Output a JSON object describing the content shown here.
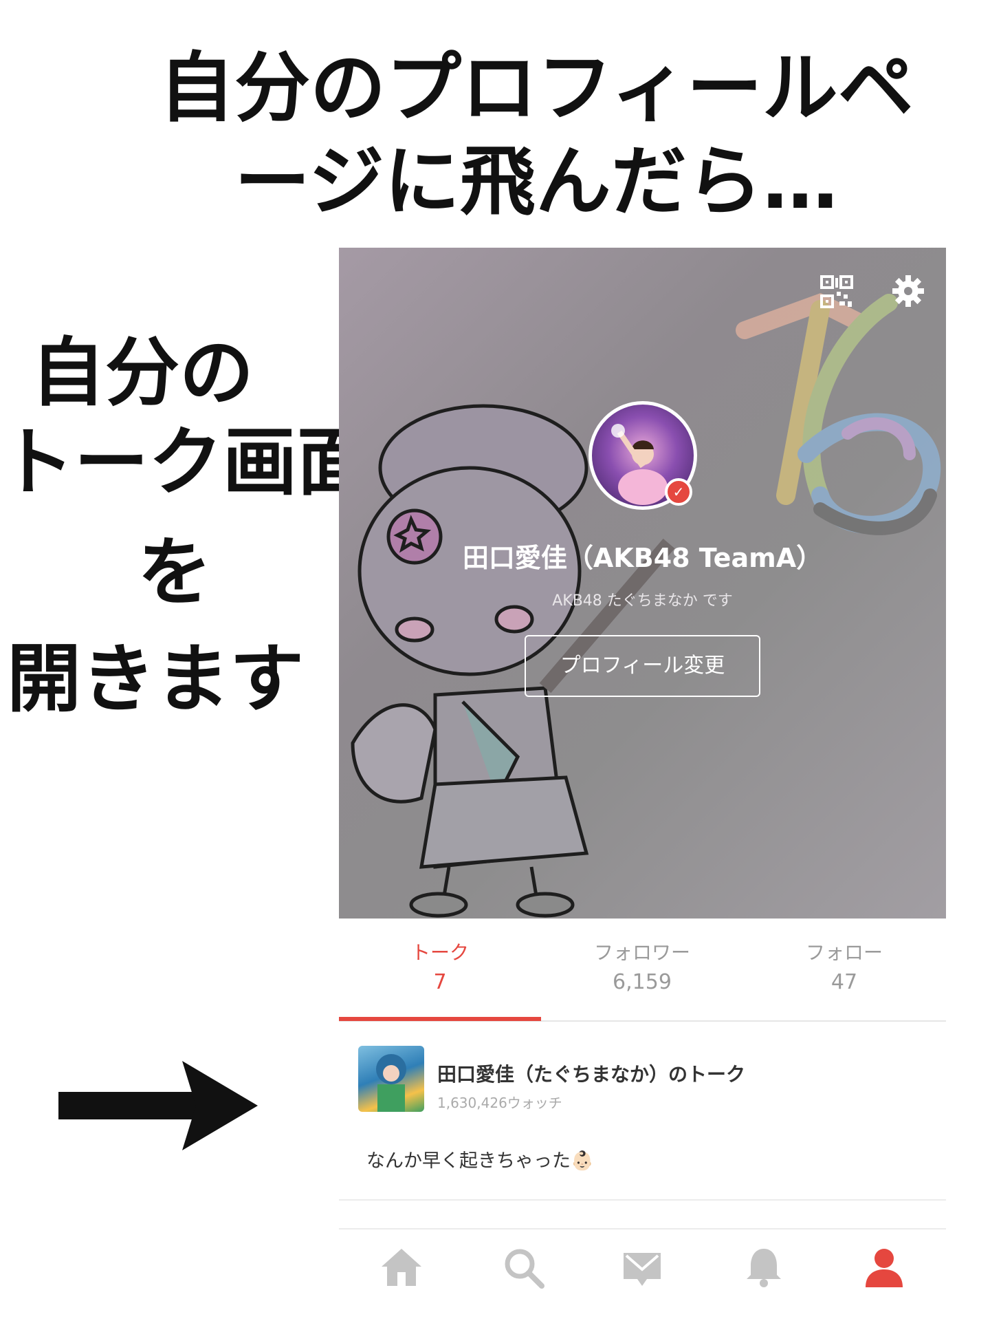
{
  "caption": {
    "title_line1": "自分のプロフィールペ",
    "title_line2": "ージに飛んだら…",
    "side_line1": "自分の",
    "side_line2": "トーク画面",
    "side_line3": "を",
    "side_line4": "開きます"
  },
  "profile": {
    "name": "田口愛佳（AKB48 TeamA）",
    "bio": "AKB48 たぐちまなか です",
    "edit_button": "プロフィール変更",
    "icons": [
      "qr-code-icon",
      "gear-icon",
      "verified-badge"
    ]
  },
  "stats": [
    {
      "label": "トーク",
      "count": "7",
      "active": true
    },
    {
      "label": "フォロワー",
      "count": "6,159",
      "active": false
    },
    {
      "label": "フォロー",
      "count": "47",
      "active": false
    }
  ],
  "talk": {
    "title": "田口愛佳（たぐちまなか）のトーク",
    "watch_count": "1,630,426ウォッチ",
    "message": "なんか早く起きちゃった👶🏻"
  },
  "nav": {
    "items": [
      "home-icon",
      "search-icon",
      "mail-icon",
      "bell-icon",
      "profile-icon"
    ],
    "active": "profile-icon"
  },
  "colors": {
    "accent": "#e5473f",
    "inactive": "#9a9a9a",
    "nav_inactive": "#c4c4c4"
  }
}
